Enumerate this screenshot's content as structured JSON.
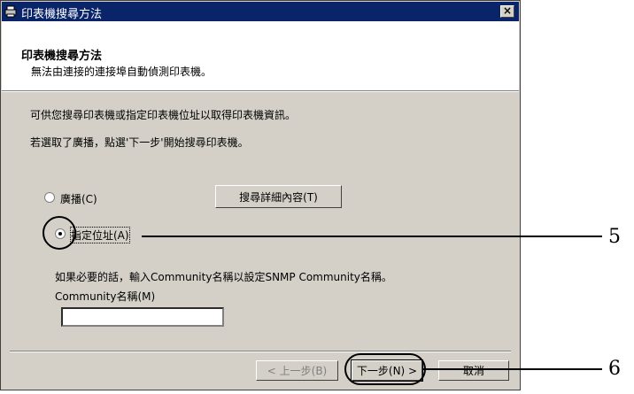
{
  "window": {
    "title": "印表機搜尋方法",
    "close_label": "×"
  },
  "header": {
    "title": "印表機搜尋方法",
    "subtitle": "無法由連接的連接埠自動偵測印表機。"
  },
  "body": {
    "line1": "可供您搜尋印表機或指定印表機位址以取得印表機資訊。",
    "line2": "若選取了廣播，點選'下一步'開始搜尋印表機。"
  },
  "options": {
    "broadcast_label": "廣播(C)",
    "specify_label": "指定位址(A)",
    "details_button": "搜尋詳細內容(T)",
    "selected": "specify"
  },
  "community": {
    "hint": "如果必要的話，輸入Community名稱以設定SNMP Community名稱。",
    "label": "Community名稱(M)",
    "value": ""
  },
  "buttons": {
    "back": "< 上一步(B)",
    "next": "下一步(N) >",
    "cancel": "取消"
  },
  "callouts": {
    "c5": "5",
    "c6": "6"
  }
}
